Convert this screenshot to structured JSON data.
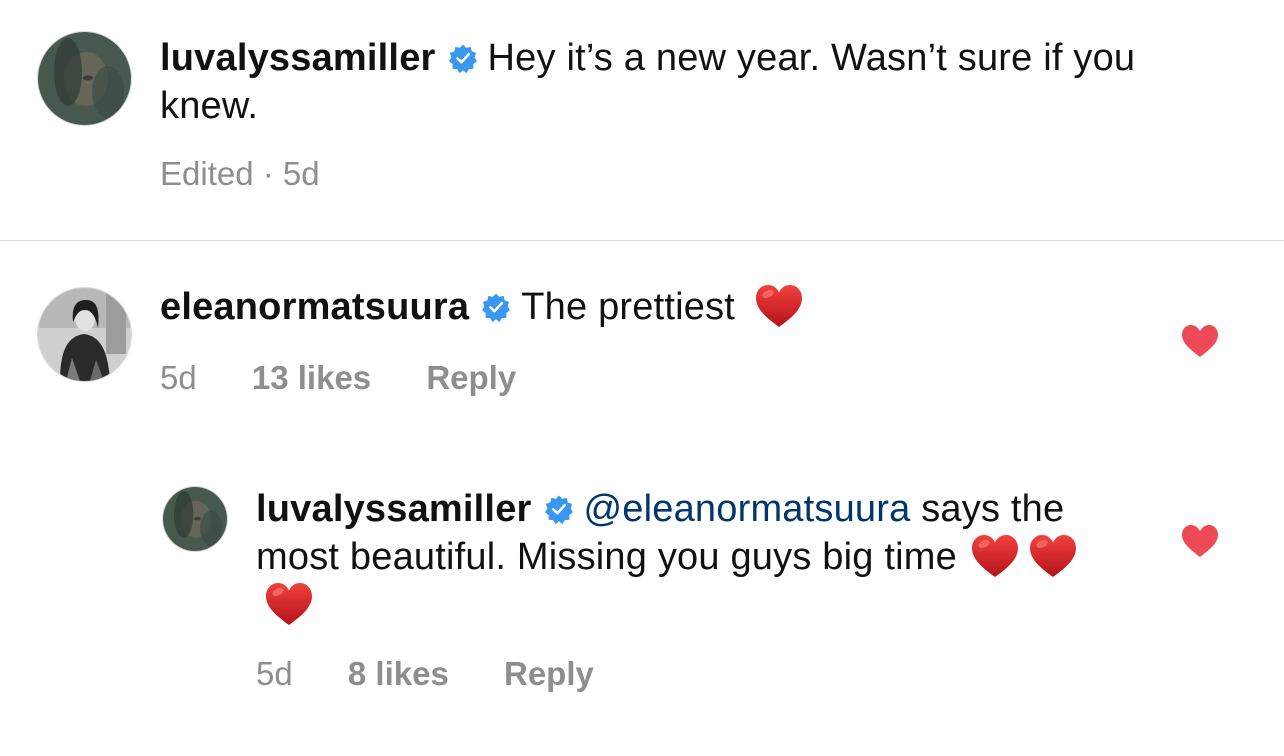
{
  "colors": {
    "verified_badge": "#3897f0",
    "mention_link": "#00376b",
    "meta_text": "#8e8e8e",
    "like_heart": "#ed4956",
    "emoji_heart": "#d81e25"
  },
  "comments": [
    {
      "username": "luvalyssamiller",
      "verified": true,
      "text": "Hey it’s a new year. Wasn’t sure if you knew.",
      "meta": {
        "edited_time": "Edited · 5d"
      },
      "liked": false
    },
    {
      "username": "eleanormatsuura",
      "verified": true,
      "text": "The prettiest",
      "emoji": [
        "red-heart"
      ],
      "meta": {
        "time": "5d",
        "likes": "13 likes",
        "reply": "Reply"
      },
      "liked": true,
      "replies": [
        {
          "username": "luvalyssamiller",
          "verified": true,
          "mention": "@eleanormatsuura",
          "text": "says the most beautiful. Missing you guys big time",
          "emoji": [
            "red-heart",
            "red-heart",
            "red-heart"
          ],
          "meta": {
            "time": "5d",
            "likes": "8 likes",
            "reply": "Reply"
          },
          "liked": true
        }
      ]
    }
  ]
}
